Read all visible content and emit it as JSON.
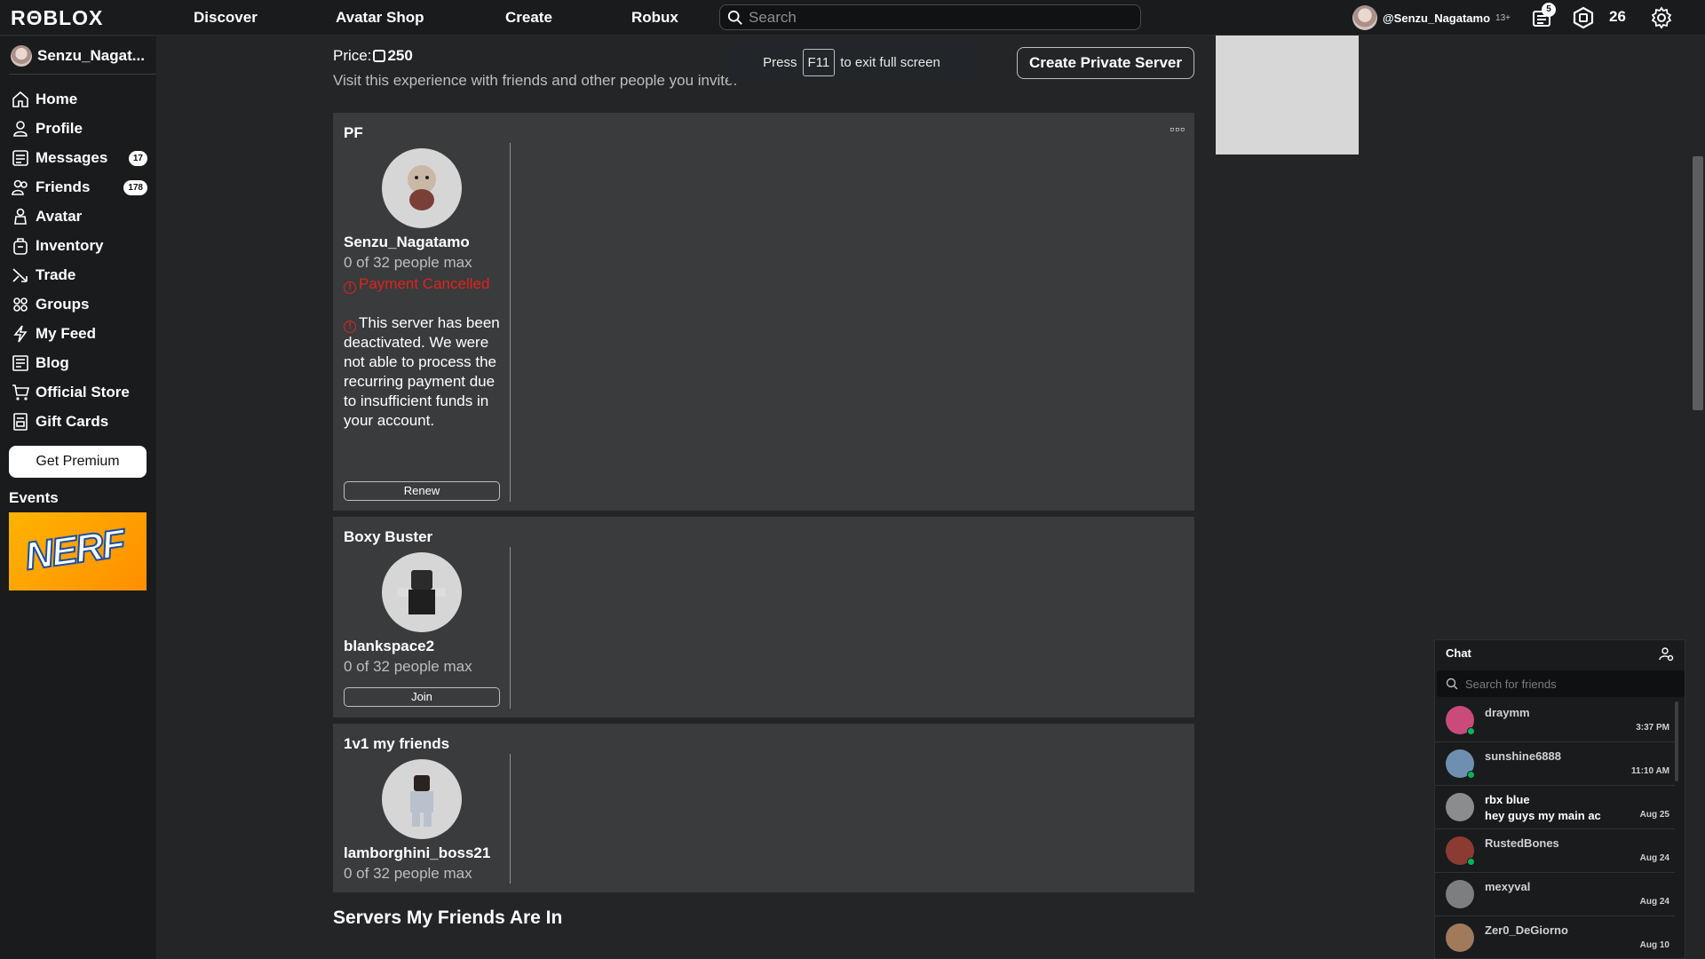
{
  "topbar": {
    "logo": "RΘBLOX",
    "nav": [
      "Discover",
      "Avatar Shop",
      "Create",
      "Robux"
    ],
    "search_placeholder": "Search",
    "username": "@Senzu_Nagatamo",
    "age_tag": "13+",
    "notification_count": "5",
    "robux": "26"
  },
  "sidebar": {
    "username": "Senzu_Nagat...",
    "items": [
      {
        "label": "Home",
        "icon": "home-icon"
      },
      {
        "label": "Profile",
        "icon": "profile-icon"
      },
      {
        "label": "Messages",
        "icon": "messages-icon",
        "badge": "17"
      },
      {
        "label": "Friends",
        "icon": "friends-icon",
        "badge": "178"
      },
      {
        "label": "Avatar",
        "icon": "avatar-icon"
      },
      {
        "label": "Inventory",
        "icon": "inventory-icon"
      },
      {
        "label": "Trade",
        "icon": "trade-icon"
      },
      {
        "label": "Groups",
        "icon": "groups-icon"
      },
      {
        "label": "My Feed",
        "icon": "feed-icon"
      },
      {
        "label": "Blog",
        "icon": "blog-icon"
      },
      {
        "label": "Official Store",
        "icon": "cart-icon"
      },
      {
        "label": "Gift Cards",
        "icon": "gift-card-icon"
      }
    ],
    "premium_label": "Get Premium",
    "events_label": "Events",
    "event_banner_text": "NERF"
  },
  "main": {
    "price_label": "Price:",
    "price_value": "250",
    "visit_text": "Visit this experience with friends and other people you invite.",
    "create_private_label": "Create Private Server",
    "fullscreen_toast": {
      "before": "Press",
      "key": "F11",
      "after": "to exit full screen"
    },
    "servers": [
      {
        "title": "PF",
        "owner": "Senzu_Nagatamo",
        "capacity": "0 of 32 people max",
        "status": "Payment Cancelled",
        "message": "This server has been deactivated. We were not able to process the recurring payment due to insufficient funds in your account.",
        "button": "Renew"
      },
      {
        "title": "Boxy Buster",
        "owner": "blankspace2",
        "capacity": "0 of 32 people max",
        "button": "Join"
      },
      {
        "title": "1v1 my friends",
        "owner": "lamborghini_boss21",
        "capacity": "0 of 32 people max"
      }
    ],
    "friends_servers_heading": "Servers My Friends Are In"
  },
  "chat": {
    "title": "Chat",
    "search_placeholder": "Search for friends",
    "conversations": [
      {
        "name": "draymm",
        "message": "",
        "time": "3:37 PM",
        "online": true
      },
      {
        "name": "sunshine6888",
        "message": "",
        "time": "11:10 AM",
        "online": true
      },
      {
        "name": "rbx blue",
        "message": "hey guys my main ac",
        "time": "Aug 25",
        "online": false
      },
      {
        "name": "RustedBones",
        "message": "",
        "time": "Aug 24",
        "online": true
      },
      {
        "name": "mexyval",
        "message": "",
        "time": "Aug 24",
        "online": false
      },
      {
        "name": "Zer0_DeGiorno",
        "message": "",
        "time": "Aug 10",
        "online": false
      }
    ]
  },
  "colors": {
    "background": "#232527",
    "card": "#393b3d",
    "topbar": "#191b1d",
    "error": "#e2231a",
    "online": "#02b757"
  }
}
